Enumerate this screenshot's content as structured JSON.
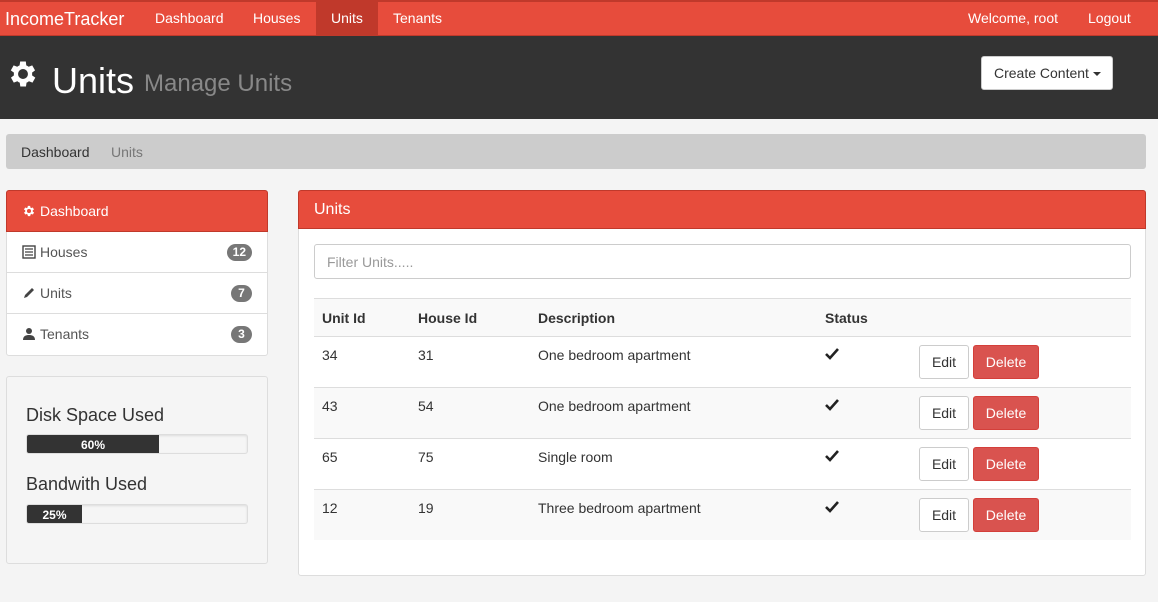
{
  "app": {
    "brand": "IncomeTracker",
    "nav": [
      "Dashboard",
      "Houses",
      "Units",
      "Tenants"
    ],
    "welcome": "Welcome, root",
    "logout": "Logout"
  },
  "header": {
    "title": "Units",
    "subtitle": "Manage Units",
    "create_button": "Create Content",
    "icon": "gear-icon"
  },
  "breadcrumb": [
    "Dashboard",
    "Units"
  ],
  "sidebar": {
    "items": [
      {
        "label": "Dashboard",
        "icon": "gear-icon"
      },
      {
        "label": "Houses",
        "icon": "list-icon",
        "count": "12"
      },
      {
        "label": "Units",
        "icon": "pencil-icon",
        "count": "7"
      },
      {
        "label": "Tenants",
        "icon": "user-icon",
        "count": "3"
      }
    ]
  },
  "stats": {
    "disk": {
      "label": "Disk Space Used",
      "value": "60%",
      "fraction": 0.6
    },
    "bandwidth": {
      "label": "Bandwith Used",
      "value": "25%",
      "fraction": 0.25
    }
  },
  "panel": {
    "title": "Units",
    "filter_placeholder": "Filter Units.....",
    "columns": [
      "Unit Id",
      "House Id",
      "Description",
      "Status"
    ],
    "rows": [
      {
        "unit_id": "34",
        "house_id": "31",
        "description": "One bedroom apartment",
        "status": "check"
      },
      {
        "unit_id": "43",
        "house_id": "54",
        "description": "One bedroom apartment",
        "status": "check"
      },
      {
        "unit_id": "65",
        "house_id": "75",
        "description": "Single room",
        "status": "check"
      },
      {
        "unit_id": "12",
        "house_id": "19",
        "description": "Three bedroom apartment",
        "status": "check"
      }
    ],
    "edit_label": "Edit",
    "delete_label": "Delete"
  },
  "colors": {
    "accent": "#e74c3c",
    "accent_dark": "#c0392b",
    "header_bg": "#333333",
    "delete": "#d9534f"
  }
}
